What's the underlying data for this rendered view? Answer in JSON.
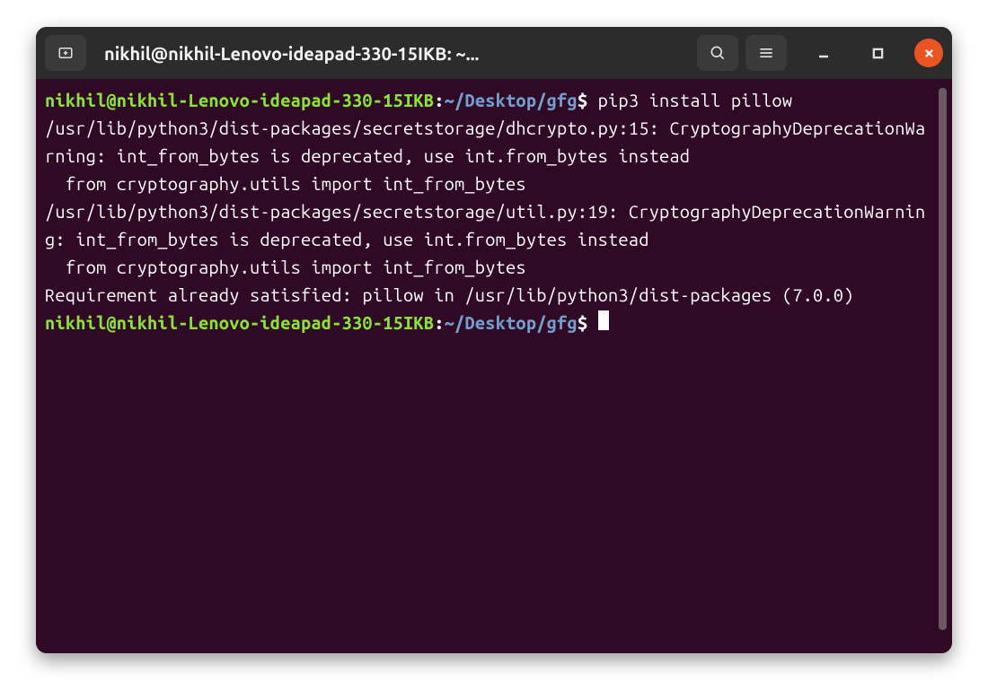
{
  "window": {
    "title": "nikhil@nikhil-Lenovo-ideapad-330-15IKB: ~..."
  },
  "prompt1": {
    "user_host": "nikhil@nikhil-Lenovo-ideapad-330-15IKB",
    "colon": ":",
    "path_prefix": "~",
    "path": "/Desktop/gfg",
    "dollar": "$",
    "command": " pip3 install pillow"
  },
  "output": {
    "line1": "/usr/lib/python3/dist-packages/secretstorage/dhcrypto.py:15: CryptographyDeprecationWarning: int_from_bytes is deprecated, use int.from_bytes instead",
    "line2": "  from cryptography.utils import int_from_bytes",
    "line3": "/usr/lib/python3/dist-packages/secretstorage/util.py:19: CryptographyDeprecationWarning: int_from_bytes is deprecated, use int.from_bytes instead",
    "line4": "  from cryptography.utils import int_from_bytes",
    "line5": "Requirement already satisfied: pillow in /usr/lib/python3/dist-packages (7.0.0)"
  },
  "prompt2": {
    "user_host": "nikhil@nikhil-Lenovo-ideapad-330-15IKB",
    "colon": ":",
    "path_prefix": "~",
    "path": "/Desktop/gfg",
    "dollar": "$"
  }
}
